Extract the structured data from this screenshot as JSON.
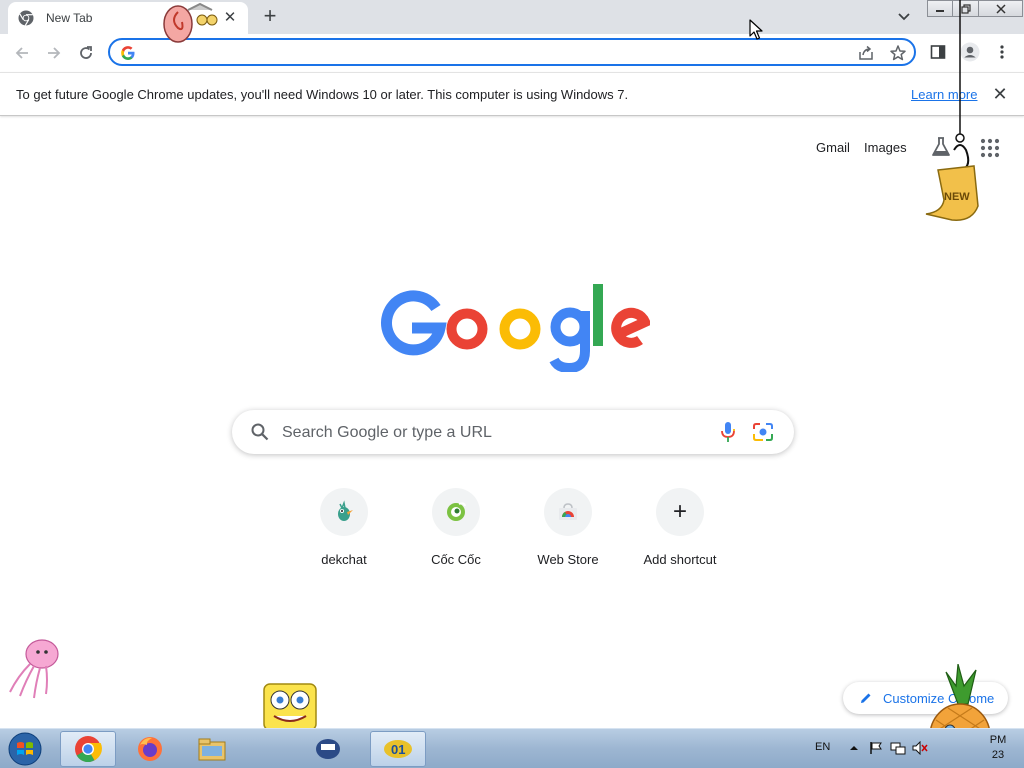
{
  "browser": {
    "tab_title": "New Tab",
    "new_tab_symbol": "+",
    "close_symbol": "✕",
    "window_controls": [
      "minimize-icon",
      "restore-icon",
      "close-icon"
    ],
    "omnibox_value": "",
    "toolbar_icons": [
      "back-icon",
      "forward-icon",
      "reload-icon",
      "share-icon",
      "bookmark-star-icon",
      "side-panel-icon",
      "profile-icon",
      "menu-kebab-icon"
    ]
  },
  "infobar": {
    "message": "To get future Google Chrome updates, you'll need Windows 10 or later. This computer is using Windows 7.",
    "link_label": "Learn more",
    "close_symbol": "✕"
  },
  "ntp": {
    "top_links": [
      {
        "label": "Gmail"
      },
      {
        "label": "Images"
      }
    ],
    "search_placeholder": "Search Google or type a URL",
    "shortcuts": [
      {
        "label": "dekchat",
        "icon": "dekchat-icon"
      },
      {
        "label": "Cốc Cốc",
        "icon": "coccoc-icon"
      },
      {
        "label": "Web Store",
        "icon": "webstore-icon"
      },
      {
        "label": "Add shortcut",
        "icon": "plus-icon",
        "symbol": "+"
      }
    ],
    "customize_label": "Customize Chrome",
    "colors": {
      "accent": "#1a73e8",
      "google_blue": "#4285f4",
      "google_red": "#ea4335",
      "google_yellow": "#fbbc05",
      "google_green": "#34a853"
    }
  },
  "taskbar": {
    "language": "EN",
    "clock_time": "PM",
    "clock_date": "23",
    "items": [
      "start-orb-icon",
      "chrome-icon",
      "firefox-icon",
      "file-explorer-icon",
      "spongebob-app-icon",
      "active-app-icon"
    ]
  },
  "decorations": [
    "snail-icon",
    "new-tag-icon",
    "jellyfish-icon",
    "spongebob-icon",
    "pineapple-house-icon"
  ]
}
